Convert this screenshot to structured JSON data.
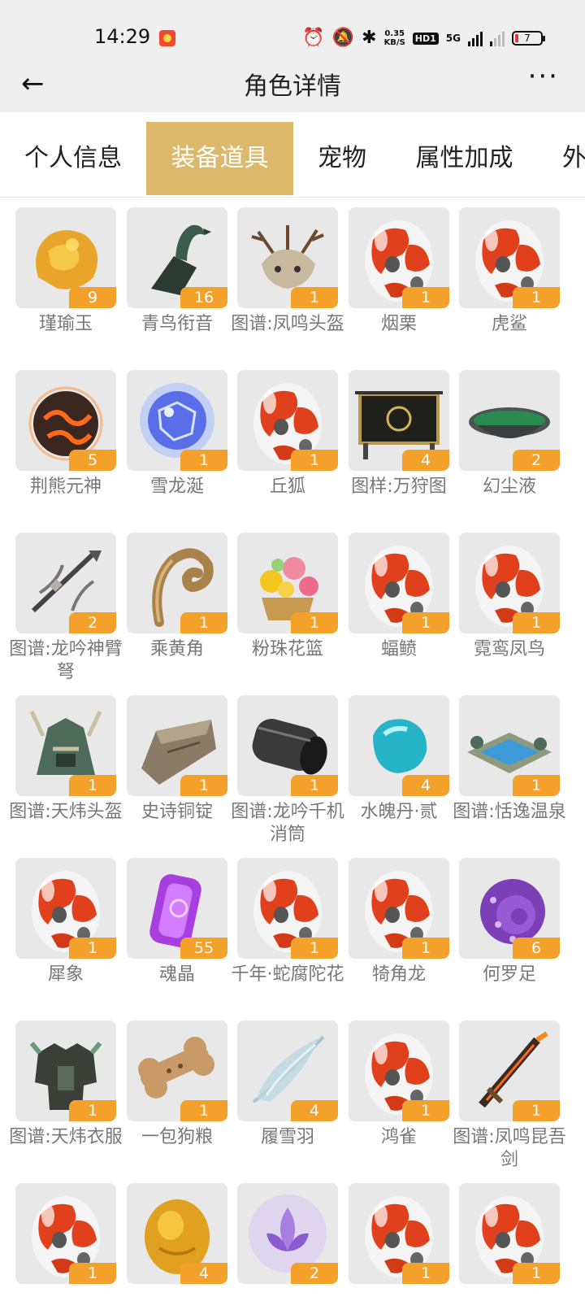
{
  "status_bar": {
    "time": "14:29",
    "net_speed_value": "0.35",
    "net_speed_unit": "KB/S",
    "hd_label": "HD1",
    "signal_label": "5G",
    "battery_level": "7",
    "icons": [
      "app-notification-icon",
      "alarm-icon",
      "mute-icon",
      "bluetooth-icon",
      "network-speed",
      "hd-icon",
      "signal-5g-icon",
      "signal-2-icon",
      "battery-icon"
    ]
  },
  "header": {
    "title": "角色详情",
    "back_icon": "←",
    "more_icon": "···"
  },
  "tabs": [
    {
      "label": "个人信息",
      "active": false
    },
    {
      "label": "装备道具",
      "active": true
    },
    {
      "label": "宠物",
      "active": false
    },
    {
      "label": "属性加成",
      "active": false
    },
    {
      "label": "外",
      "active": false
    }
  ],
  "colors": {
    "accent_tab": "#dcb86a",
    "badge": "#f3a12a",
    "tile_bg": "#e8e8e8",
    "item_name": "#777777"
  },
  "items": [
    {
      "name": "瑾瑜玉",
      "count": "9",
      "icon": "amber-jade-icon"
    },
    {
      "name": "青鸟衔音",
      "count": "16",
      "icon": "bird-whistle-icon"
    },
    {
      "name": "图谱:凤鸣头盔",
      "count": "1",
      "icon": "antler-helmet-icon"
    },
    {
      "name": "烟栗",
      "count": "1",
      "icon": "pet-egg-icon"
    },
    {
      "name": "虎鲨",
      "count": "1",
      "icon": "pet-egg-icon"
    },
    {
      "name": "荆熊元神",
      "count": "5",
      "icon": "fire-orb-icon"
    },
    {
      "name": "雪龙涎",
      "count": "1",
      "icon": "crystal-orb-icon"
    },
    {
      "name": "丘狐",
      "count": "1",
      "icon": "pet-egg-icon"
    },
    {
      "name": "图样:万狩图",
      "count": "4",
      "icon": "screen-banner-icon"
    },
    {
      "name": "幻尘液",
      "count": "2",
      "icon": "green-bowl-icon"
    },
    {
      "name": "图谱:龙吟神臂弩",
      "count": "2",
      "icon": "crossbow-icon"
    },
    {
      "name": "乘黄角",
      "count": "1",
      "icon": "curved-horn-icon"
    },
    {
      "name": "粉珠花篮",
      "count": "1",
      "icon": "flower-basket-icon"
    },
    {
      "name": "蝠鲼",
      "count": "1",
      "icon": "pet-egg-icon"
    },
    {
      "name": "霓鸾凤鸟",
      "count": "1",
      "icon": "pet-egg-icon"
    },
    {
      "name": "图谱:天炜头盔",
      "count": "1",
      "icon": "jade-helmet-icon"
    },
    {
      "name": "史诗铜锭",
      "count": "1",
      "icon": "bronze-ingot-icon"
    },
    {
      "name": "图谱:龙吟千机消筒",
      "count": "1",
      "icon": "iron-barrel-icon"
    },
    {
      "name": "水魄丹·贰",
      "count": "4",
      "icon": "teal-gem-icon"
    },
    {
      "name": "图谱:恬逸温泉",
      "count": "1",
      "icon": "hot-spring-icon"
    },
    {
      "name": "犀象",
      "count": "1",
      "icon": "pet-egg-icon"
    },
    {
      "name": "魂晶",
      "count": "55",
      "icon": "soul-crystal-icon"
    },
    {
      "name": "千年·蛇腐陀花",
      "count": "1",
      "icon": "pet-egg-icon"
    },
    {
      "name": "犄角龙",
      "count": "1",
      "icon": "pet-egg-icon"
    },
    {
      "name": "何罗足",
      "count": "6",
      "icon": "tentacle-icon"
    },
    {
      "name": "图谱:天炜衣服",
      "count": "1",
      "icon": "armor-icon"
    },
    {
      "name": "一包狗粮",
      "count": "1",
      "icon": "dog-bone-icon"
    },
    {
      "name": "履雪羽",
      "count": "4",
      "icon": "snow-feather-icon"
    },
    {
      "name": "鸿雀",
      "count": "1",
      "icon": "pet-egg-icon"
    },
    {
      "name": "图谱:凤鸣昆吾剑",
      "count": "1",
      "icon": "flame-sword-icon"
    },
    {
      "name": "",
      "count": "1",
      "icon": "pet-egg-icon"
    },
    {
      "name": "",
      "count": "4",
      "icon": "gold-jade-icon"
    },
    {
      "name": "",
      "count": "2",
      "icon": "lotus-glow-icon"
    },
    {
      "name": "",
      "count": "1",
      "icon": "pet-egg-icon"
    },
    {
      "name": "",
      "count": "1",
      "icon": "pet-egg-icon"
    }
  ]
}
